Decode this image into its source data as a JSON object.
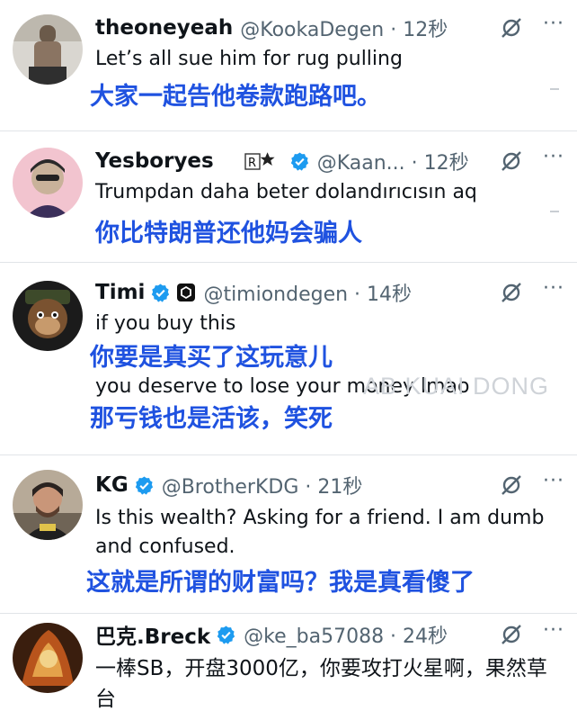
{
  "tweets": [
    {
      "name": "theoneyeah",
      "handle": "@KookaDegen · 12秒",
      "text": "Let’s all sue him for rug pulling",
      "translation": "大家一起告他卷款跑路吧。",
      "verified": false
    },
    {
      "name": "Yesboryes",
      "handle": "@Kaan... · 12秒",
      "text": "Trumpdan daha beter dolandırıcısın aq",
      "translation": "你比特朗普还他妈会骗人",
      "verified": true,
      "affiliate_badge": "R★"
    },
    {
      "name": "Timi",
      "handle": "@timiondegen · 14秒",
      "text": "if you buy this",
      "translation": "你要是真买了这玩意儿",
      "text2": "you deserve to lose your money lmao",
      "translation2": "那亏钱也是活该，笑死",
      "verified": true
    },
    {
      "name": "KG",
      "handle": "@BrotherKDG · 21秒",
      "text": "Is this wealth? Asking for a friend. I am dumb and confused.",
      "translation": "这就是所谓的财富吗？我是真看傻了",
      "verified": true
    },
    {
      "name": "巴克.Breck",
      "handle": "@ke_ba57088 · 24秒",
      "text": "一棒SB，开盘3000亿，你要攻打火星啊，果然草台",
      "verified": true
    }
  ],
  "watermark": "AB KUAI DONG",
  "icons": {
    "grok": "grok-icon",
    "more": "more-icon",
    "verified": "verified-badge-icon"
  },
  "colors": {
    "translation_blue": "#1f52e0",
    "verified_blue": "#1d9bf0",
    "secondary_text": "#536471"
  }
}
